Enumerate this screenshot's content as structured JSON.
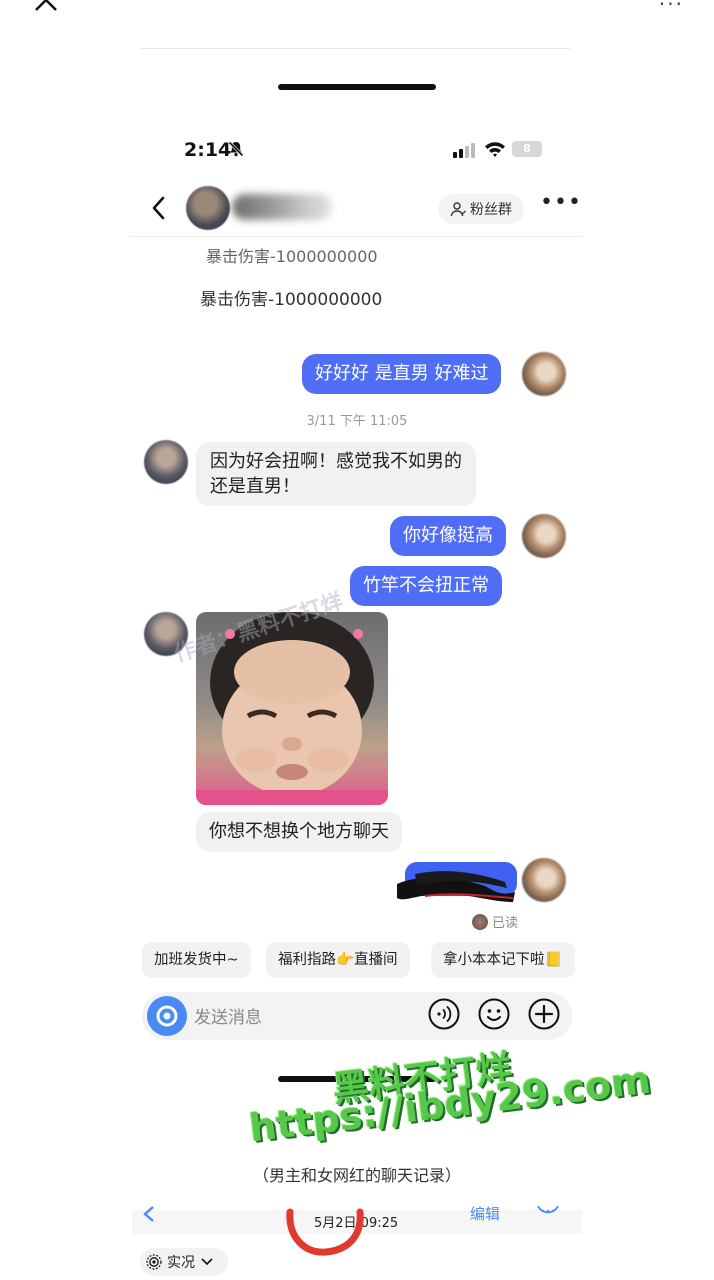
{
  "status_bar": {
    "time": "2:14",
    "battery": "8"
  },
  "header": {
    "fan_group": "粉丝群"
  },
  "system_lines": [
    "暴击伤害-1000000000",
    "暴击伤害-1000000000"
  ],
  "messages": {
    "m1": "好好好 是直男 好难过",
    "timestamp": "3/11 下午 11:05",
    "m2_line1": "因为好会扭啊！感觉我不如男的",
    "m2_line2": "还是直男！",
    "m3": "你好像挺高",
    "m4": "竹竿不会扭正常",
    "m5": "你想不想换个地方聊天",
    "read_status": "已读"
  },
  "quick_replies": [
    "加班发货中~",
    "福利指路👉直播间",
    "拿小本本记下啦📒"
  ],
  "input": {
    "placeholder": "发送消息"
  },
  "overlay": {
    "line1": "黑料不打烊",
    "line2": "https://ibdy29.com"
  },
  "caption": "（男主和女网红的聊天记录）",
  "bottom": {
    "date": "5月2日  09:25",
    "edit": "编辑",
    "live": "实况"
  },
  "watermark": "作者：黑料不打烊"
}
